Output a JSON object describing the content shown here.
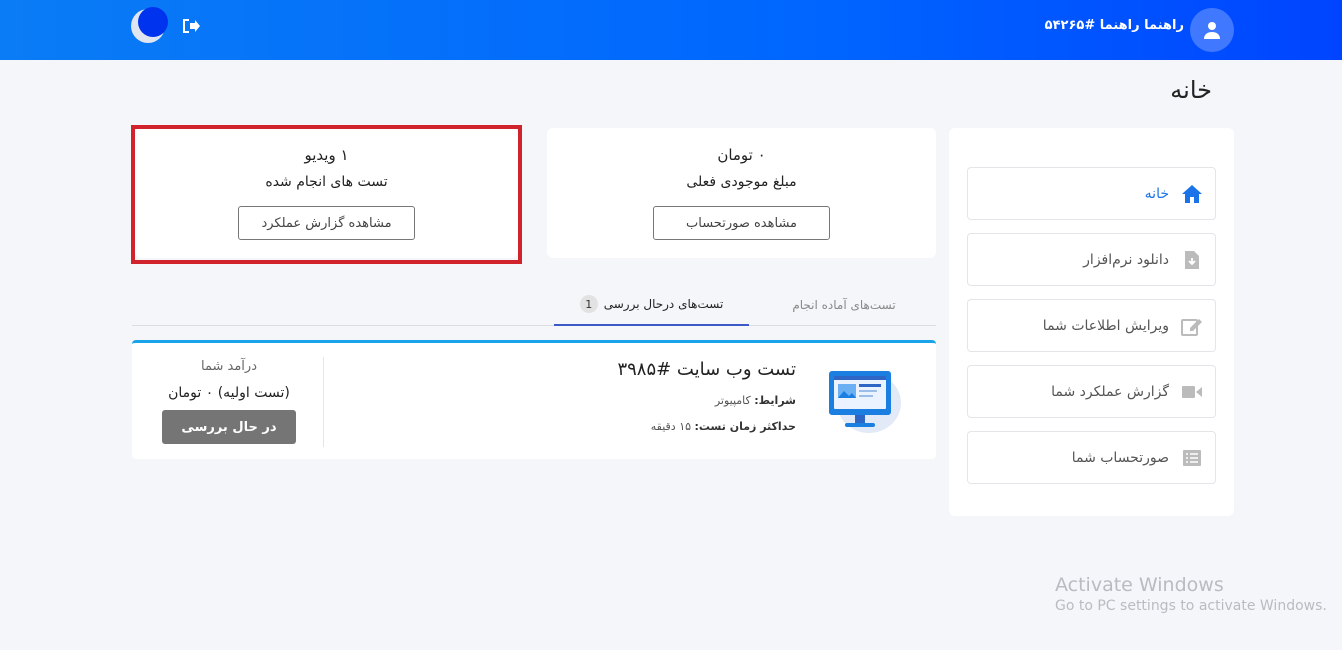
{
  "header": {
    "user_name": "راهنما راهنما #۵۴۲۶۵",
    "icons": [
      "moon-icon",
      "logout-icon",
      "user-icon"
    ]
  },
  "page": {
    "title": "خانه"
  },
  "sidebar": {
    "items": [
      {
        "label": "خانه",
        "icon": "home-icon",
        "active": true
      },
      {
        "label": "دانلود نرم‌افزار",
        "icon": "download-file-icon"
      },
      {
        "label": "ویرایش اطلاعات شما",
        "icon": "edit-icon"
      },
      {
        "label": "گزارش عملکرد شما",
        "icon": "video-icon"
      },
      {
        "label": "صورتحساب شما",
        "icon": "list-icon"
      }
    ]
  },
  "stats": {
    "balance": {
      "value": "۰ تومان",
      "label": "مبلغ موجودی فعلی",
      "button": "مشاهده صورتحساب"
    },
    "videos": {
      "value": "۱ ویدیو",
      "label": "تست های انجام شده",
      "button": "مشاهده گزارش عملکرد"
    }
  },
  "tabs": {
    "ready": "تست‌های آماده انجام",
    "in_review": "تست‌های درحال بررسی",
    "in_review_count": "1"
  },
  "test": {
    "title": "تست وب سایت #۳۹۸۵",
    "conditions_label": "شرایط:",
    "conditions_value": "کامپیوتر",
    "max_time_label": "حداکثر زمان تست:",
    "max_time_value": "۱۵ دقیقه",
    "income_title": "درآمد شما",
    "income_value": "(تست اولیه) ۰ تومان",
    "status_button": "در حال بررسی"
  },
  "watermark": {
    "line1": "Activate Windows",
    "line2": "Go to PC settings to activate Windows."
  },
  "colors": {
    "header_gradient_start": "#0a7cf5",
    "header_gradient_end": "#0044ff",
    "highlight_border": "#d0232b",
    "active_link": "#1a73e8"
  }
}
